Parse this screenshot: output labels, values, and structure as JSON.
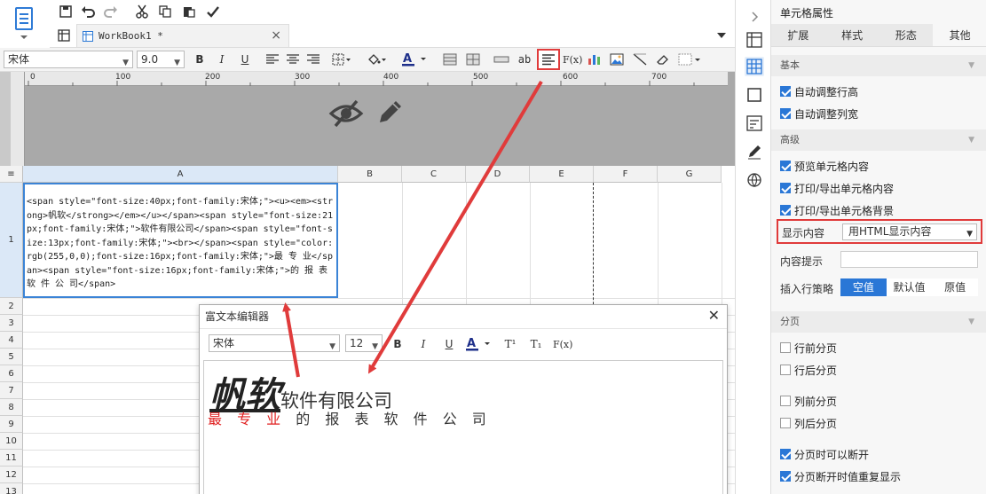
{
  "workbook_tab": {
    "name": "WorkBook1 *"
  },
  "format_bar": {
    "font_name": "宋体",
    "font_size": "9.0",
    "bold": "B",
    "italic": "I",
    "underline": "U",
    "wrap_text": "ab",
    "formula": "F(x)"
  },
  "ruler": {
    "ticks": [
      "0",
      "100",
      "200",
      "300",
      "400",
      "500",
      "600",
      "700"
    ]
  },
  "grid": {
    "columns": [
      "A",
      "B",
      "C",
      "D",
      "E",
      "F",
      "G"
    ],
    "rows": [
      "1",
      "2",
      "3",
      "4",
      "5",
      "6",
      "7",
      "8",
      "9",
      "10",
      "11",
      "12",
      "13"
    ],
    "row_head_symbol": "≡",
    "cell_a1": "<span style=\"font-size:40px;font-family:宋体;\"><u><em><strong>帆软</strong></em></u></span><span style=\"font-size:21px;font-family:宋体;\">软件有限公司</span><span style=\"font-size:13px;font-family:宋体;\"><br></span><span style=\"color:rgb(255,0,0);font-size:16px;font-family:宋体;\">最 专 业</span><span style=\"font-size:16px;font-family:宋体;\">的 报 表 软 件 公 司</span>"
  },
  "rich_text_editor": {
    "title": "富文本编辑器",
    "font_name": "宋体",
    "font_size": "12",
    "bold": "B",
    "italic": "I",
    "underline": "U",
    "superscript": "T¹",
    "subscript": "T₁",
    "formula": "F(x)",
    "content_big": "帆软",
    "content_company": "软件有限公司",
    "content_red": "最 专 业",
    "content_rest": "的 报 表 软 件 公 司"
  },
  "panel": {
    "title": "单元格属性",
    "tabs": [
      "扩展",
      "样式",
      "形态",
      "其他"
    ],
    "active_tab": "其他",
    "sections": {
      "basic": "基本",
      "advanced": "高级",
      "pagination": "分页"
    },
    "checkboxes": [
      {
        "label": "自动调整行高",
        "checked": true
      },
      {
        "label": "自动调整列宽",
        "checked": true
      },
      {
        "label": "预览单元格内容",
        "checked": true
      },
      {
        "label": "打印/导出单元格内容",
        "checked": true
      },
      {
        "label": "打印/导出单元格背景",
        "checked": true
      },
      {
        "label": "行前分页",
        "checked": false
      },
      {
        "label": "行后分页",
        "checked": false
      },
      {
        "label": "列前分页",
        "checked": false
      },
      {
        "label": "列后分页",
        "checked": false
      },
      {
        "label": "分页时可以断开",
        "checked": true
      },
      {
        "label": "分页断开时值重复显示",
        "checked": true
      }
    ],
    "display_content_label": "显示内容",
    "display_content_value": "用HTML显示内容",
    "content_hint_label": "内容提示",
    "insert_policy_label": "插入行策略",
    "insert_policy_options": [
      "空值",
      "默认值",
      "原值"
    ],
    "insert_policy_selected": "空值"
  },
  "colors": {
    "accent": "#2a77d6",
    "highlight": "#e03b3b",
    "red_text": "#e02020"
  }
}
